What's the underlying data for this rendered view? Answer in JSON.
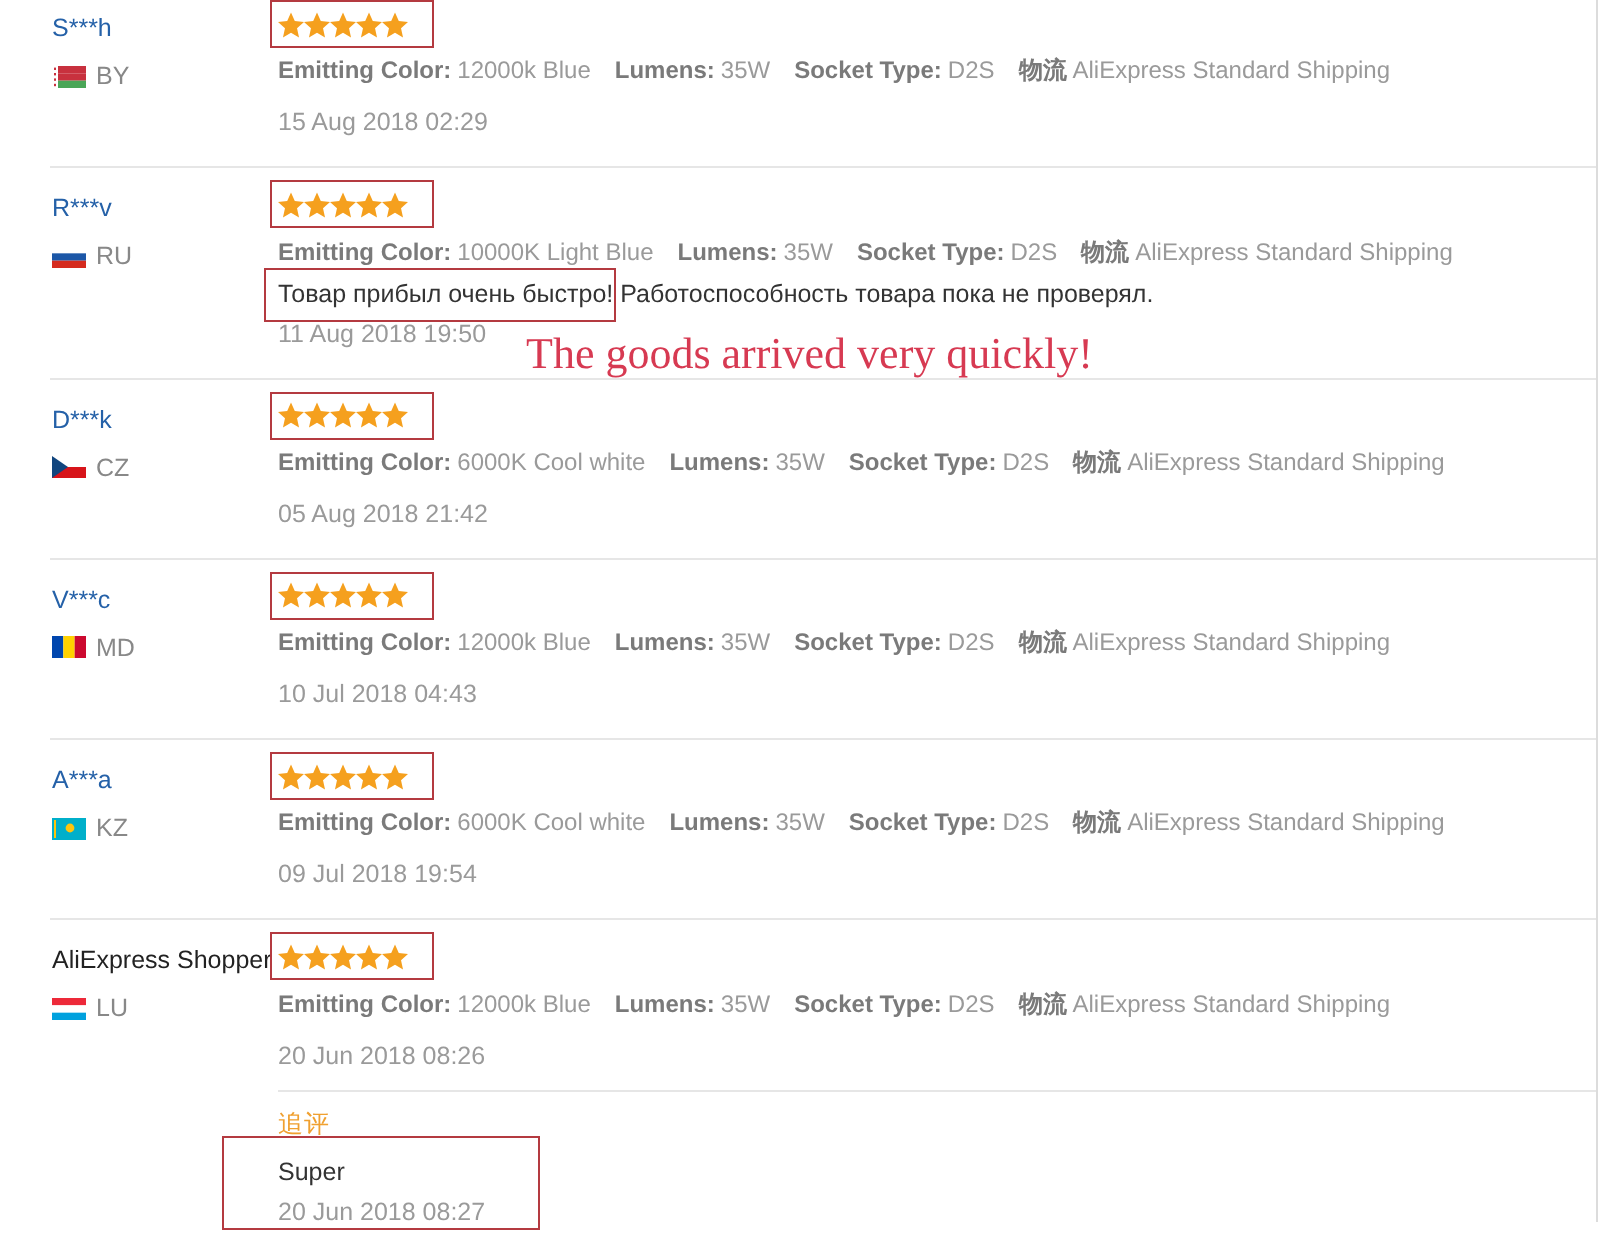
{
  "reviews": [
    {
      "name": "S***h",
      "name_linked": true,
      "country": "BY",
      "flag": {
        "kind": "hoist-band",
        "parts": [
          {
            "color": "#ffffff"
          },
          {
            "color": "#c8313e"
          },
          {
            "color": "#c8313e"
          },
          {
            "color": "#4aa657"
          }
        ]
      },
      "stars": 5,
      "stars_marked": true,
      "attributes": [
        {
          "label": "Emitting Color:",
          "value": "12000k Blue"
        },
        {
          "label": "Lumens:",
          "value": "35W"
        },
        {
          "label": "Socket Type:",
          "value": "D2S"
        },
        {
          "label": "物流",
          "value": "AliExpress Standard Shipping"
        }
      ],
      "date": "15 Aug 2018 02:29"
    },
    {
      "name": "R***v",
      "name_linked": true,
      "country": "RU",
      "flag": {
        "kind": "stripes-h",
        "parts": [
          {
            "color": "#ffffff"
          },
          {
            "color": "#1c57a7"
          },
          {
            "color": "#d52b1e"
          }
        ]
      },
      "stars": 5,
      "stars_marked": true,
      "attributes": [
        {
          "label": "Emitting Color:",
          "value": "10000K Light Blue"
        },
        {
          "label": "Lumens:",
          "value": "35W"
        },
        {
          "label": "Socket Type:",
          "value": "D2S"
        },
        {
          "label": "物流",
          "value": "AliExpress Standard Shipping"
        }
      ],
      "comment": "Товар прибыл очень быстро! Работоспособность товара пока не проверял.",
      "comment_marked": true,
      "date": "11 Aug 2018 19:50",
      "note": "The goods arrived very quickly!"
    },
    {
      "name": "D***k",
      "name_linked": true,
      "country": "CZ",
      "flag": {
        "kind": "triangle",
        "parts": [
          {
            "color": "#ffffff"
          },
          {
            "color": "#d7141a"
          },
          {
            "color": "#11457e"
          }
        ]
      },
      "stars": 5,
      "stars_marked": true,
      "attributes": [
        {
          "label": "Emitting Color:",
          "value": "6000K Cool white"
        },
        {
          "label": "Lumens:",
          "value": "35W"
        },
        {
          "label": "Socket Type:",
          "value": "D2S"
        },
        {
          "label": "物流",
          "value": "AliExpress Standard Shipping"
        }
      ],
      "date": "05 Aug 2018 21:42"
    },
    {
      "name": "V***c",
      "name_linked": true,
      "country": "MD",
      "flag": {
        "kind": "stripes-v",
        "parts": [
          {
            "color": "#0046ae"
          },
          {
            "color": "#ffd200"
          },
          {
            "color": "#cc092f"
          }
        ]
      },
      "stars": 5,
      "stars_marked": true,
      "attributes": [
        {
          "label": "Emitting Color:",
          "value": "12000k Blue"
        },
        {
          "label": "Lumens:",
          "value": "35W"
        },
        {
          "label": "Socket Type:",
          "value": "D2S"
        },
        {
          "label": "物流",
          "value": "AliExpress Standard Shipping"
        }
      ],
      "date": "10 Jul 2018 04:43"
    },
    {
      "name": "A***a",
      "name_linked": true,
      "country": "KZ",
      "flag": {
        "kind": "emblem",
        "parts": [
          {
            "color": "#00afca"
          },
          {
            "color": "#fec50c"
          }
        ]
      },
      "stars": 5,
      "stars_marked": true,
      "attributes": [
        {
          "label": "Emitting Color:",
          "value": "6000K Cool white"
        },
        {
          "label": "Lumens:",
          "value": "35W"
        },
        {
          "label": "Socket Type:",
          "value": "D2S"
        },
        {
          "label": "物流",
          "value": "AliExpress Standard Shipping"
        }
      ],
      "date": "09 Jul 2018 19:54"
    },
    {
      "name": "AliExpress Shopper",
      "name_linked": false,
      "country": "LU",
      "flag": {
        "kind": "stripes-h",
        "parts": [
          {
            "color": "#ed2939"
          },
          {
            "color": "#ffffff"
          },
          {
            "color": "#00a1de"
          }
        ]
      },
      "stars": 5,
      "stars_marked": true,
      "attributes": [
        {
          "label": "Emitting Color:",
          "value": "12000k Blue"
        },
        {
          "label": "Lumens:",
          "value": "35W"
        },
        {
          "label": "Socket Type:",
          "value": "D2S"
        },
        {
          "label": "物流",
          "value": "AliExpress Standard Shipping"
        }
      ],
      "date": "20 Jun 2018 08:26",
      "follow_up": {
        "label": "追评",
        "text": "Super",
        "date": "20 Jun 2018 08:27",
        "marked": true
      }
    }
  ]
}
